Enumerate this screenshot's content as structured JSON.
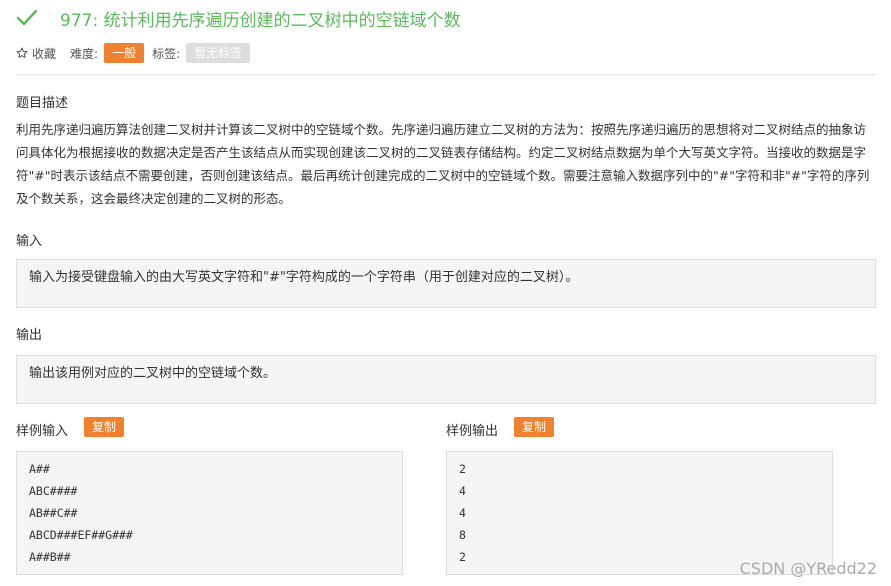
{
  "problem": {
    "title": "977: 统计利用先序遍历创建的二叉树中的空链域个数",
    "status_color": "#5cb85c"
  },
  "meta": {
    "favorite_label": "收藏",
    "difficulty_label": "难度:",
    "difficulty_value": "一般",
    "tags_label": "标签:",
    "tags_value": "暂无标签"
  },
  "sections": {
    "description_heading": "题目描述",
    "description_text": "利用先序递归遍历算法创建二叉树并计算该二叉树中的空链域个数。先序递归遍历建立二叉树的方法为：按照先序递归遍历的思想将对二叉树结点的抽象访问具体化为根据接收的数据决定是否产生该结点从而实现创建该二叉树的二叉链表存储结构。约定二叉树结点数据为单个大写英文字符。当接收的数据是字符\"#\"时表示该结点不需要创建，否则创建该结点。最后再统计创建完成的二叉树中的空链域个数。需要注意输入数据序列中的\"#\"字符和非\"#\"字符的序列及个数关系，这会最终决定创建的二叉树的形态。",
    "input_heading": "输入",
    "input_text": "输入为接受键盘输入的由大写英文字符和\"#\"字符构成的一个字符串（用于创建对应的二叉树）。",
    "output_heading": "输出",
    "output_text": "输出该用例对应的二叉树中的空链域个数。"
  },
  "samples": {
    "input_heading": "样例输入",
    "output_heading": "样例输出",
    "copy_label": "复制",
    "input_lines": [
      "A##",
      "ABC####",
      "AB##C##",
      "ABCD###EF##G###",
      "A##B##"
    ],
    "output_lines": [
      "2",
      "4",
      "4",
      "8",
      "2"
    ]
  },
  "watermark": "CSDN @YRedd22",
  "colors": {
    "accent": "#f0812f",
    "success": "#5cb85c",
    "tag_bg": "#dddddd"
  }
}
